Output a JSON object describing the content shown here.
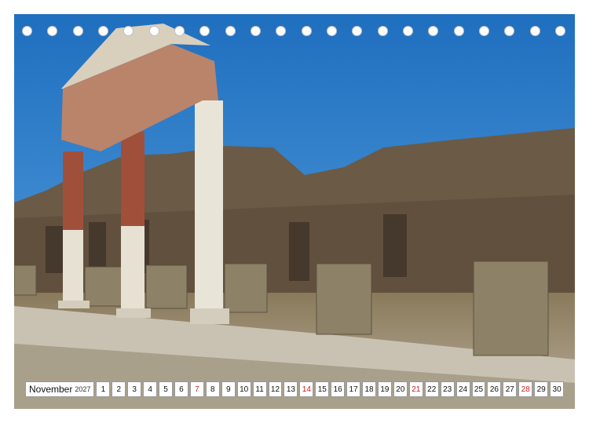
{
  "calendar": {
    "month": "November",
    "year": "2027",
    "days": [
      "1",
      "2",
      "3",
      "4",
      "5",
      "6",
      "7",
      "8",
      "9",
      "10",
      "11",
      "12",
      "13",
      "14",
      "15",
      "16",
      "17",
      "18",
      "19",
      "20",
      "21",
      "22",
      "23",
      "24",
      "25",
      "26",
      "27",
      "28",
      "29",
      "30"
    ],
    "highlight_days": [
      "7",
      "14",
      "21",
      "28"
    ],
    "highlight_color": "#d02020"
  },
  "binding": {
    "hole_count": 22
  }
}
